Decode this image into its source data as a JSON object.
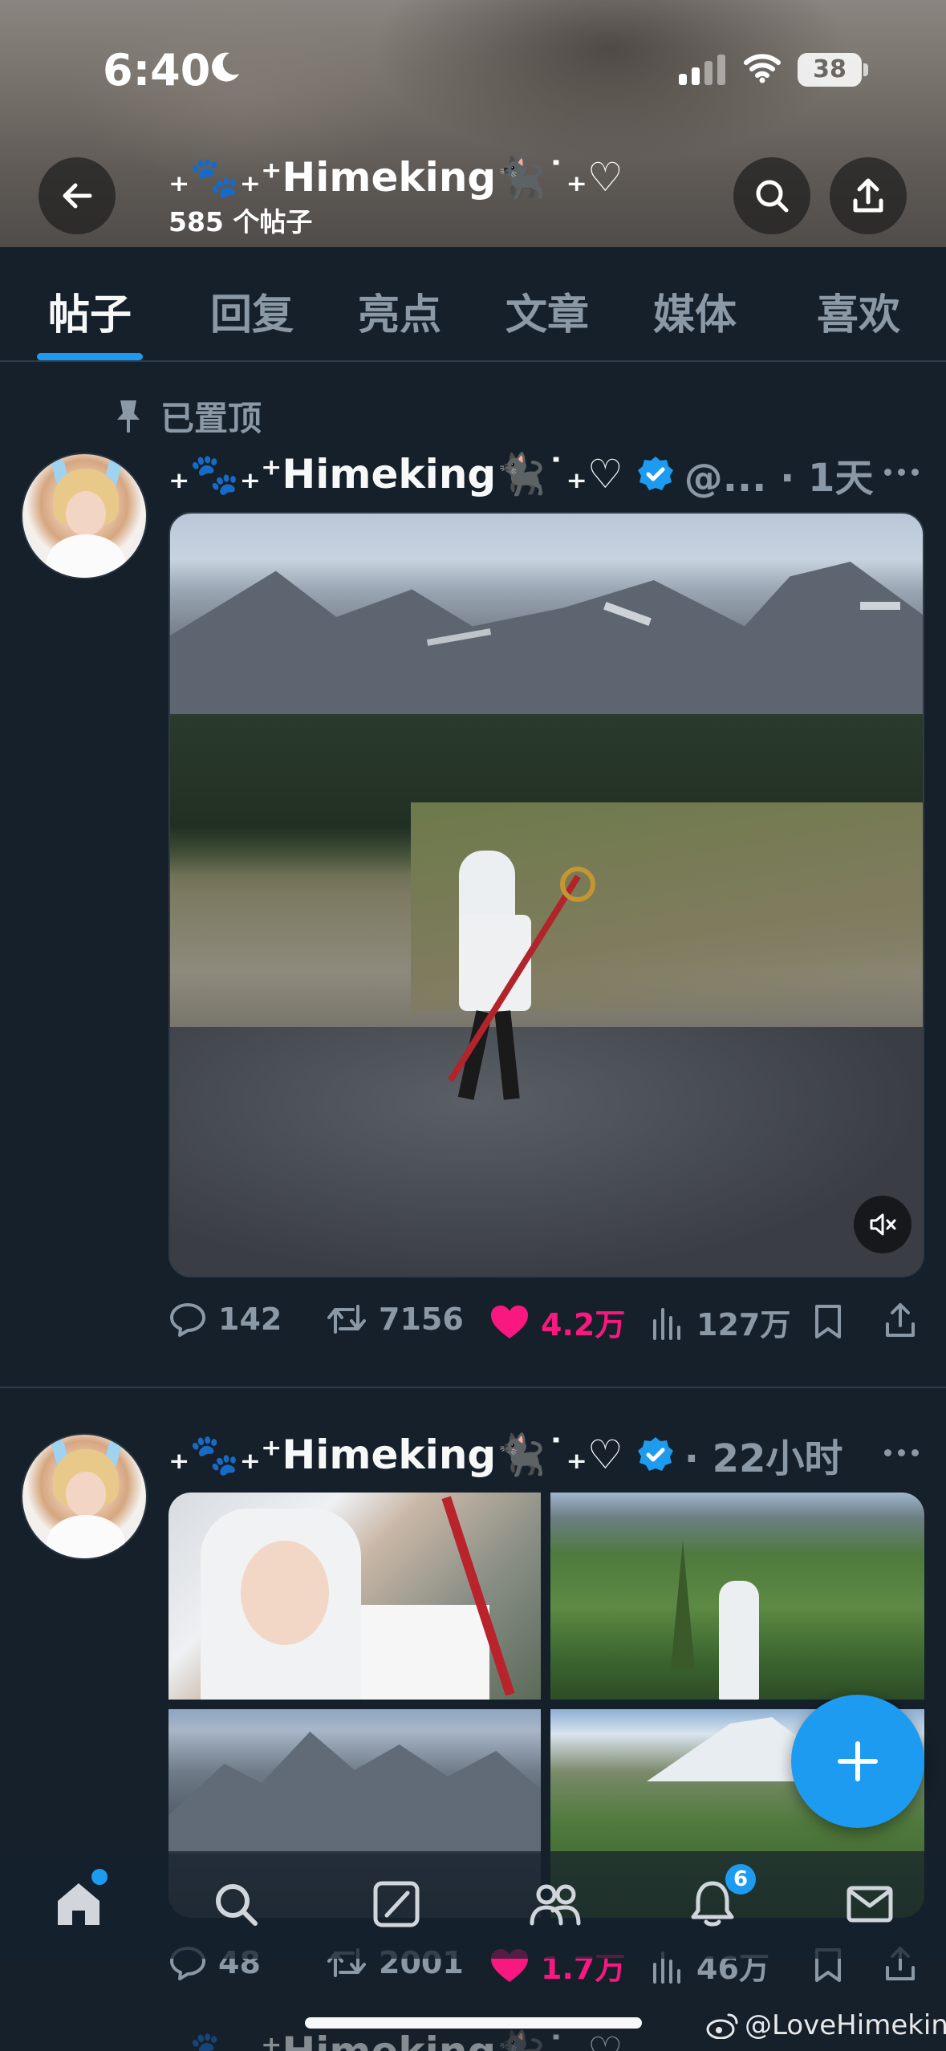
{
  "status_bar": {
    "time": "6:40",
    "battery": "38"
  },
  "header": {
    "profile_name": "₊🐾₊⁺Himeking🐈‍⬛˙₊♡",
    "post_count": "585 个帖子"
  },
  "tabs": [
    {
      "label": "帖子"
    },
    {
      "label": "回复"
    },
    {
      "label": "亮点"
    },
    {
      "label": "文章"
    },
    {
      "label": "媒体"
    },
    {
      "label": "喜欢"
    }
  ],
  "posts": [
    {
      "pinned_label": "已置顶",
      "author": "₊🐾₊⁺Himeking🐈‍⬛˙₊♡",
      "meta": "@... · 1天",
      "stats": {
        "replies": "142",
        "reposts": "7156",
        "likes": "4.2万",
        "views": "127万"
      }
    },
    {
      "author": "₊🐾₊⁺Himeking🐈‍⬛˙₊♡",
      "meta": "· 22小时",
      "stats": {
        "replies": "48",
        "reposts": "2001",
        "likes": "1.7万",
        "views": "46万"
      }
    }
  ],
  "bottom_nav": {
    "notifications_badge": "6"
  },
  "watermark": "@LoveHimeking",
  "colors": {
    "accent": "#1d9bf0",
    "like": "#f91880",
    "background": "#15202b",
    "muted": "#8b98a5"
  },
  "icons": [
    "back-arrow-icon",
    "search-icon",
    "share-icon",
    "pin-icon",
    "verified-icon",
    "more-icon",
    "reply-icon",
    "repost-icon",
    "heart-icon",
    "views-icon",
    "bookmark-icon",
    "mute-icon",
    "plus-icon",
    "home-icon",
    "grok-icon",
    "people-icon",
    "bell-icon",
    "mail-icon",
    "weibo-icon"
  ]
}
